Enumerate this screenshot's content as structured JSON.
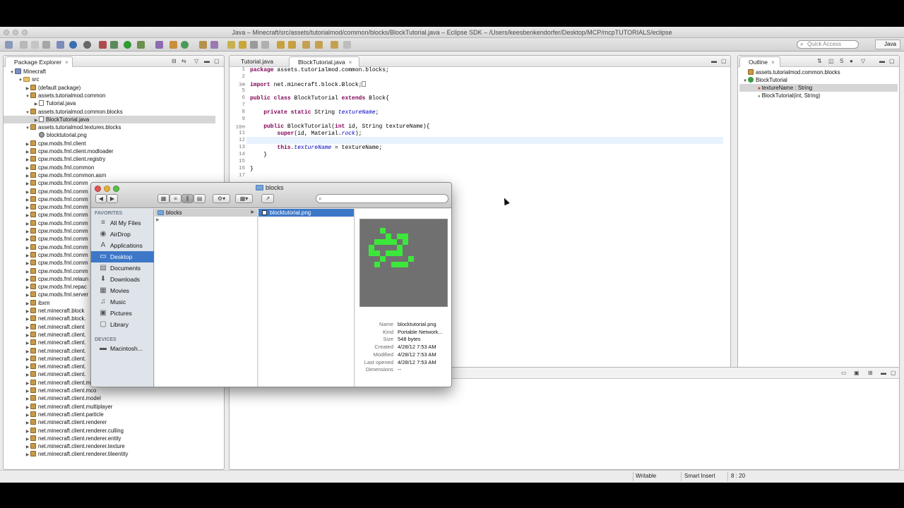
{
  "window": {
    "title": "Java – Minecraft/src/assets/tutorialmod/common/blocks/BlockTutorial.java – Eclipse SDK – /Users/keesbenkendorfer/Desktop/MCP/mcpTUTORIALS/eclipse"
  },
  "toolbar": {
    "quick_access_placeholder": "Quick Access",
    "perspective": "Java"
  },
  "package_explorer": {
    "title": "Package Explorer",
    "items": [
      {
        "label": "Minecraft",
        "type": "project",
        "toggle": "▼"
      },
      {
        "label": "src",
        "type": "folder",
        "toggle": "▼"
      },
      {
        "label": "(default package)",
        "type": "package",
        "toggle": "▶"
      },
      {
        "label": "assets.tutorialmod.common",
        "type": "package",
        "toggle": "▼"
      },
      {
        "label": "Tutorial.java",
        "type": "java",
        "toggle": "▶"
      },
      {
        "label": "assets.tutorialmod.common.blocks",
        "type": "package",
        "toggle": "▼"
      },
      {
        "label": "BlockTutorial.java",
        "type": "java",
        "toggle": "▶"
      },
      {
        "label": "assets.tutorialmod.textures.blocks",
        "type": "package",
        "toggle": "▼"
      },
      {
        "label": "blocktutorial.png",
        "type": "image",
        "toggle": ""
      },
      {
        "label": "cpw.mods.fml.client",
        "type": "package",
        "toggle": "▶"
      },
      {
        "label": "cpw.mods.fml.client.modloader",
        "type": "package",
        "toggle": "▶"
      },
      {
        "label": "cpw.mods.fml.client.registry",
        "type": "package",
        "toggle": "▶"
      },
      {
        "label": "cpw.mods.fml.common",
        "type": "package",
        "toggle": "▶"
      },
      {
        "label": "cpw.mods.fml.common.asm",
        "type": "package",
        "toggle": "▶"
      },
      {
        "label": "cpw.mods.fml.comm",
        "type": "package",
        "toggle": "▶"
      },
      {
        "label": "cpw.mods.fml.comm",
        "type": "package",
        "toggle": "▶"
      },
      {
        "label": "cpw.mods.fml.comm",
        "type": "package",
        "toggle": "▶"
      },
      {
        "label": "cpw.mods.fml.comm",
        "type": "package",
        "toggle": "▶"
      },
      {
        "label": "cpw.mods.fml.comm",
        "type": "package",
        "toggle": "▶"
      },
      {
        "label": "cpw.mods.fml.comm",
        "type": "package",
        "toggle": "▶"
      },
      {
        "label": "cpw.mods.fml.comm",
        "type": "package",
        "toggle": "▶"
      },
      {
        "label": "cpw.mods.fml.comm",
        "type": "package",
        "toggle": "▶"
      },
      {
        "label": "cpw.mods.fml.comm",
        "type": "package",
        "toggle": "▶"
      },
      {
        "label": "cpw.mods.fml.comm",
        "type": "package",
        "toggle": "▶"
      },
      {
        "label": "cpw.mods.fml.comm",
        "type": "package",
        "toggle": "▶"
      },
      {
        "label": "cpw.mods.fml.comm",
        "type": "package",
        "toggle": "▶"
      },
      {
        "label": "cpw.mods.fml.relaun",
        "type": "package",
        "toggle": "▶"
      },
      {
        "label": "cpw.mods.fml.repac",
        "type": "package",
        "toggle": "▶"
      },
      {
        "label": "cpw.mods.fml.server",
        "type": "package",
        "toggle": "▶"
      },
      {
        "label": "ibxm",
        "type": "package",
        "toggle": "▶"
      },
      {
        "label": "net.minecraft.block",
        "type": "package",
        "toggle": "▶"
      },
      {
        "label": "net.minecraft.block.",
        "type": "package",
        "toggle": "▶"
      },
      {
        "label": "net.minecraft.client",
        "type": "package",
        "toggle": "▶"
      },
      {
        "label": "net.minecraft.client.",
        "type": "package",
        "toggle": "▶"
      },
      {
        "label": "net.minecraft.client.",
        "type": "package",
        "toggle": "▶"
      },
      {
        "label": "net.minecraft.client.",
        "type": "package",
        "toggle": "▶"
      },
      {
        "label": "net.minecraft.client.",
        "type": "package",
        "toggle": "▶"
      },
      {
        "label": "net.minecraft.client.",
        "type": "package",
        "toggle": "▶"
      },
      {
        "label": "net.minecraft.client.",
        "type": "package",
        "toggle": "▶"
      },
      {
        "label": "net.minecraft.client.main",
        "type": "package",
        "toggle": "▶"
      },
      {
        "label": "net.minecraft.client.mco",
        "type": "package",
        "toggle": "▶"
      },
      {
        "label": "net.minecraft.client.model",
        "type": "package",
        "toggle": "▶"
      },
      {
        "label": "net.minecraft.client.multiplayer",
        "type": "package",
        "toggle": "▶"
      },
      {
        "label": "net.minecraft.client.particle",
        "type": "package",
        "toggle": "▶"
      },
      {
        "label": "net.minecraft.client.renderer",
        "type": "package",
        "toggle": "▶"
      },
      {
        "label": "net.minecraft.client.renderer.culling",
        "type": "package",
        "toggle": "▶"
      },
      {
        "label": "net.minecraft.client.renderer.entity",
        "type": "package",
        "toggle": "▶"
      },
      {
        "label": "net.minecraft.client.renderer.texture",
        "type": "package",
        "toggle": "▶"
      },
      {
        "label": "net.minecraft.client.renderer.tileentity",
        "type": "package",
        "toggle": "▶"
      }
    ]
  },
  "editor": {
    "tabs": [
      "Tutorial.java",
      "BlockTutorial.java"
    ],
    "line_numbers": [
      "1",
      "2",
      "3⊕",
      "5",
      "6",
      "7",
      "8",
      "9",
      "10⊖",
      "11",
      "12",
      "13",
      "14",
      "15",
      "16",
      "17"
    ],
    "lines": [
      [
        {
          "t": "package",
          "k": 1
        },
        {
          "t": " assets.tutorialmod.common.blocks;"
        }
      ],
      [],
      [
        {
          "t": "import",
          "k": 1
        },
        {
          "t": " net.minecraft.block.Block;"
        },
        {
          "t": "[]"
        }
      ],
      [],
      [
        {
          "t": "public",
          "k": 1
        },
        {
          "t": " "
        },
        {
          "t": "class",
          "k": 1
        },
        {
          "t": " BlockTutorial "
        },
        {
          "t": "extends",
          "k": 1
        },
        {
          "t": " Block{"
        }
      ],
      [],
      [
        {
          "t": "    "
        },
        {
          "t": "private",
          "k": 1
        },
        {
          "t": " "
        },
        {
          "t": "static",
          "k": 1
        },
        {
          "t": " String "
        },
        {
          "t": "textureName",
          "i": 1
        },
        {
          "t": ";"
        }
      ],
      [],
      [
        {
          "t": "    "
        },
        {
          "t": "public",
          "k": 1
        },
        {
          "t": " BlockTutorial("
        },
        {
          "t": "int",
          "k": 1
        },
        {
          "t": " id, String textureName){"
        }
      ],
      [
        {
          "t": "        "
        },
        {
          "t": "super",
          "k": 1
        },
        {
          "t": "(id, Material."
        },
        {
          "t": "rock",
          "i": 1
        },
        {
          "t": ");"
        }
      ],
      [],
      [
        {
          "t": "        "
        },
        {
          "t": "this",
          "k": 1
        },
        {
          "t": "."
        },
        {
          "t": "textureName",
          "i": 1
        },
        {
          "t": " = textureName;"
        }
      ],
      [
        {
          "t": "    }"
        }
      ],
      [],
      [
        {
          "t": "}"
        }
      ],
      []
    ]
  },
  "outline": {
    "title": "Outline",
    "items": [
      "assets.tutorialmod.common.blocks",
      "BlockTutorial",
      "textureName : String",
      "BlockTutorial(int, String)"
    ]
  },
  "finder": {
    "title": "blocks",
    "search_placeholder": "",
    "sidebar": {
      "favorites_header": "FAVORITES",
      "favorites": [
        {
          "label": "All My Files",
          "icon": "≡"
        },
        {
          "label": "AirDrop",
          "icon": "◉"
        },
        {
          "label": "Applications",
          "icon": "A"
        },
        {
          "label": "Desktop",
          "icon": "▭"
        },
        {
          "label": "Documents",
          "icon": "▤"
        },
        {
          "label": "Downloads",
          "icon": "⬇"
        },
        {
          "label": "Movies",
          "icon": "▦"
        },
        {
          "label": "Music",
          "icon": "♫"
        },
        {
          "label": "Pictures",
          "icon": "▣"
        },
        {
          "label": "Library",
          "icon": "▢"
        }
      ],
      "selected": "Desktop",
      "devices_header": "DEVICES",
      "devices": [
        {
          "label": "Macintosh...",
          "icon": "▬"
        }
      ]
    },
    "column1": [
      "blocks"
    ],
    "column2": [
      "blocktutorial.png"
    ],
    "info": [
      {
        "k": "Name",
        "v": "blocktutorial.png"
      },
      {
        "k": "Kind",
        "v": "Portable Network..."
      },
      {
        "k": "Size",
        "v": "548 bytes"
      },
      {
        "k": "Created",
        "v": "4/28/12 7:53 AM"
      },
      {
        "k": "Modified",
        "v": "4/28/12 7:53 AM"
      },
      {
        "k": "Last opened",
        "v": "4/28/12 7:53 AM"
      },
      {
        "k": "Dimensions",
        "v": "--"
      }
    ]
  },
  "status": {
    "writable": "Writable",
    "insert_mode": "Smart Insert",
    "position": "8 : 20"
  }
}
